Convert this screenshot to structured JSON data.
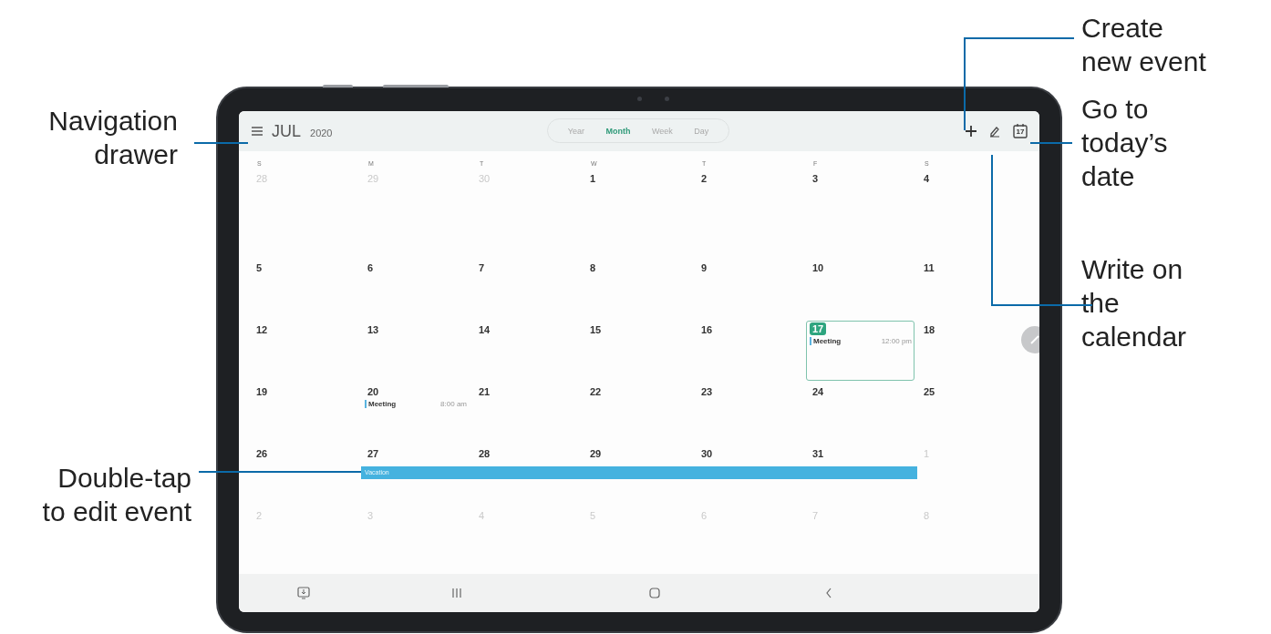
{
  "left_callouts": [
    "Navigation drawer",
    "Double-tap to edit event"
  ],
  "right_callouts": [
    "Create new event",
    "Go to today’s date",
    "Write on the calendar"
  ],
  "header": {
    "month": "JUL",
    "year": "2020",
    "today_icon_text": "17"
  },
  "view_tabs": [
    {
      "label": "Year",
      "selected": false
    },
    {
      "label": "Month",
      "selected": true
    },
    {
      "label": "Week",
      "selected": false
    },
    {
      "label": "Day",
      "selected": false
    }
  ],
  "weekdays": [
    "S",
    "M",
    "T",
    "W",
    "T",
    "F",
    "S"
  ],
  "weeks": [
    {
      "days": [
        {
          "day": "28",
          "outside": true
        },
        {
          "day": "29",
          "outside": true
        },
        {
          "day": "30",
          "outside": true
        },
        {
          "day": "1",
          "outside": false
        },
        {
          "day": "2",
          "outside": false
        },
        {
          "day": "3",
          "outside": false
        },
        {
          "day": "4",
          "outside": false
        }
      ]
    },
    {
      "days": [
        {
          "day": "5",
          "outside": false
        },
        {
          "day": "6",
          "outside": false
        },
        {
          "day": "7",
          "outside": false
        },
        {
          "day": "8",
          "outside": false
        },
        {
          "day": "9",
          "outside": false
        },
        {
          "day": "10",
          "outside": false
        },
        {
          "day": "11",
          "outside": false
        }
      ]
    },
    {
      "days": [
        {
          "day": "12",
          "outside": false
        },
        {
          "day": "13",
          "outside": false
        },
        {
          "day": "14",
          "outside": false
        },
        {
          "day": "15",
          "outside": false
        },
        {
          "day": "16",
          "outside": false
        },
        {
          "day": "17",
          "outside": false,
          "today": true,
          "events": [
            {
              "title": "Meeting",
              "time": "12:00 pm"
            }
          ]
        },
        {
          "day": "18",
          "outside": false
        }
      ]
    },
    {
      "days": [
        {
          "day": "19",
          "outside": false
        },
        {
          "day": "20",
          "outside": false,
          "events": [
            {
              "title": "Meeting",
              "time": "8:00 am"
            }
          ]
        },
        {
          "day": "21",
          "outside": false
        },
        {
          "day": "22",
          "outside": false
        },
        {
          "day": "23",
          "outside": false
        },
        {
          "day": "24",
          "outside": false
        },
        {
          "day": "25",
          "outside": false
        }
      ]
    },
    {
      "days": [
        {
          "day": "26",
          "outside": false
        },
        {
          "day": "27",
          "outside": false,
          "in_banner": true,
          "banner_title": "Vacation"
        },
        {
          "day": "28",
          "outside": false,
          "in_banner": true
        },
        {
          "day": "29",
          "outside": false,
          "in_banner": true
        },
        {
          "day": "30",
          "outside": false,
          "in_banner": true
        },
        {
          "day": "31",
          "outside": false,
          "in_banner": true
        },
        {
          "day": "1",
          "outside": true
        }
      ]
    },
    {
      "days": [
        {
          "day": "2",
          "outside": true
        },
        {
          "day": "3",
          "outside": true
        },
        {
          "day": "4",
          "outside": true
        },
        {
          "day": "5",
          "outside": true
        },
        {
          "day": "6",
          "outside": true
        },
        {
          "day": "7",
          "outside": true
        },
        {
          "day": "8",
          "outside": true
        }
      ]
    }
  ]
}
